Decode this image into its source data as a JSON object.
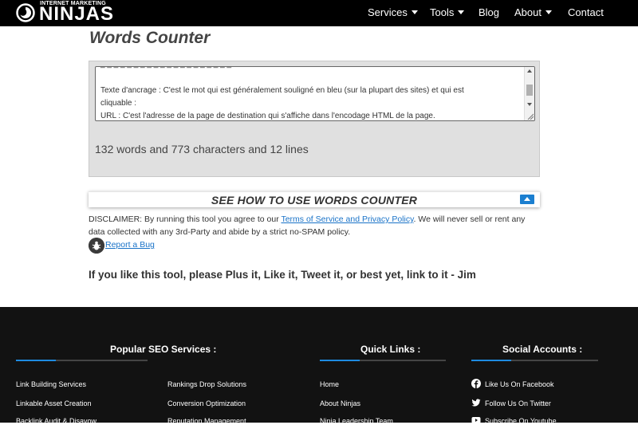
{
  "header": {
    "logo_small": "INTERNET MARKETING",
    "logo_big": "NINJAS",
    "nav": [
      {
        "label": "Services",
        "has_caret": true
      },
      {
        "label": "Tools",
        "has_caret": true
      },
      {
        "label": "Blog",
        "has_caret": false
      },
      {
        "label": "About",
        "has_caret": true
      },
      {
        "label": "Contact",
        "has_caret": false
      }
    ]
  },
  "main": {
    "title": "Words Counter",
    "textarea": {
      "lines": [
        "Texte d'ancrage : C'est le mot qui est généralement souligné en bleu (sur la plupart des sites) et qui est",
        "cliquable :",
        "URL : C'est l'adresse de la page de destination qui s'affiche dans l'encodage HTML de la page."
      ]
    },
    "stats": "132 words and 773 characters and 12 lines",
    "howto_label": "SEE HOW TO USE WORDS COUNTER",
    "disclaimer_before": "DISCLAIMER: By running this tool you agree to our ",
    "disclaimer_link": "Terms of Service and Privacy Policy",
    "disclaimer_after": ". We will never sell or rent any data collected with any 3rd-Party and abide by a strict no-SPAM policy.",
    "report_bug": "Report a Bug",
    "plus_text": "If you like this tool, please Plus it, Like it, Tweet it, or best yet, link to it - Jim"
  },
  "footer": {
    "popular_heading": "Popular SEO Services :",
    "quick_heading": "Quick Links :",
    "social_heading": "Social Accounts :",
    "popular_col1": [
      "Link Building Services",
      "Linkable Asset Creation",
      "Backlink Audit & Disavow"
    ],
    "popular_col2": [
      "Rankings Drop Solutions",
      "Conversion Optimization",
      "Reputation Management"
    ],
    "quick_links": [
      "Home",
      "About Ninjas",
      "Ninja Leadership Team"
    ],
    "social_links": [
      {
        "label": "Like Us On Facebook",
        "icon": "facebook-icon"
      },
      {
        "label": "Follow Us On Twitter",
        "icon": "twitter-icon"
      },
      {
        "label": "Subscribe On Youtube",
        "icon": "youtube-icon"
      }
    ],
    "accent_color": "#1e8be0"
  }
}
